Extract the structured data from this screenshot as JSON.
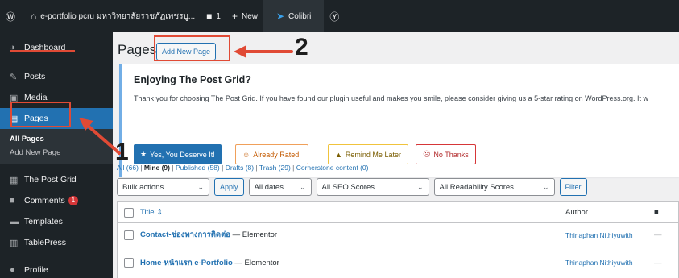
{
  "adminbar": {
    "wp_logo": "wordpress-icon",
    "site_name": "e-portfolio pcru มหาวิทยาลัยราชภัฏเพชรบู...",
    "comments_count": "1",
    "new_label": "New",
    "colibri_label": "Colibri"
  },
  "sidebar": {
    "items": [
      {
        "label": "Dashboard",
        "icon": "dashboard-icon"
      },
      {
        "label": "Posts",
        "icon": "pin-icon"
      },
      {
        "label": "Media",
        "icon": "media-icon"
      },
      {
        "label": "Pages",
        "icon": "pages-icon"
      },
      {
        "label": "The Post Grid",
        "icon": "grid-icon"
      },
      {
        "label": "Comments",
        "icon": "comment-icon",
        "badge": "1"
      },
      {
        "label": "Templates",
        "icon": "folder-icon"
      },
      {
        "label": "TablePress",
        "icon": "table-icon"
      },
      {
        "label": "Profile",
        "icon": "user-icon"
      }
    ],
    "submenu": [
      "All Pages",
      "Add New Page"
    ]
  },
  "main": {
    "title": "Pages",
    "add_new": "Add New Page"
  },
  "notice": {
    "heading": "Enjoying The Post Grid?",
    "text": "Thank you for choosing The Post Grid. If you have found our plugin useful and makes you smile, please consider giving us a 5-star rating on WordPress.org. It w",
    "buttons": [
      "Yes, You Deserve It!",
      "Already Rated!",
      "Remind Me Later",
      "No Thanks"
    ]
  },
  "views": {
    "all": "All (66)",
    "mine": "Mine (9)",
    "published": "Published (58)",
    "drafts": "Drafts (8)",
    "trash": "Trash (29)",
    "cornerstone": "Cornerstone content (0)"
  },
  "filters": {
    "bulk": "Bulk actions",
    "apply": "Apply",
    "dates": "All dates",
    "seo": "All SEO Scores",
    "readability": "All Readability Scores",
    "filter": "Filter"
  },
  "table": {
    "col_title": "Title",
    "col_author": "Author",
    "rows": [
      {
        "title": "Contact-ช่องทางการติดต่อ",
        "state": "— Elementor",
        "author": "Thinaphan Nithiyuwith",
        "dash": "—"
      },
      {
        "title": "Home-หน้าแรก e-Portfolio",
        "state": "— Elementor",
        "author": "Thinaphan Nithiyuwith",
        "dash": "—"
      }
    ]
  },
  "annotations": {
    "one": "1",
    "two": "2",
    "color": "#e04a35"
  }
}
